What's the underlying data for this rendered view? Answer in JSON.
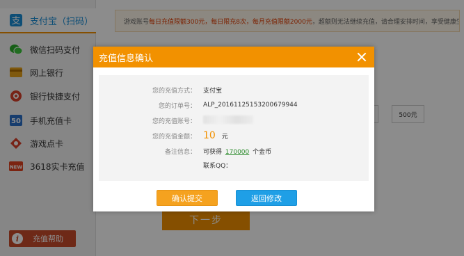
{
  "sidebar": {
    "items": [
      {
        "label": "支付宝（扫码）",
        "icon": "alipay-icon"
      },
      {
        "label": "微信扫码支付",
        "icon": "wechat-icon"
      },
      {
        "label": "网上银行",
        "icon": "bank-card-icon"
      },
      {
        "label": "银行快捷支付",
        "icon": "quick-pay-icon"
      },
      {
        "label": "手机充值卡",
        "icon": "phone-card-icon"
      },
      {
        "label": "游戏点卡",
        "icon": "game-card-icon"
      },
      {
        "label": "3618实卡充值",
        "icon": "new-badge-icon"
      }
    ],
    "help_label": "充值帮助",
    "help_icon_glyph": "i"
  },
  "notice": {
    "prefix": "游戏账号",
    "daily_limit": "每日充值限额300元，每日限充8次，每月充值限额2000元",
    "suffix": "，超额则无法继续充值，请合理安排时间，享受健康生活。"
  },
  "amount_options": [
    "元",
    "500元"
  ],
  "next_label": "下一步",
  "modal": {
    "title": "充值信息确认",
    "rows": {
      "method_label": "您的充值方式：",
      "method_value": "支付宝",
      "order_label": "您的订单号：",
      "order_value": "ALP_20161125153200679944",
      "account_label": "您的充值账号：",
      "amount_label": "您的充值金额：",
      "amount_value": "10",
      "amount_unit": "元",
      "note_label": "备注信息：",
      "note_prefix": "可获得",
      "note_gold": "170000",
      "note_suffix": "个金币",
      "qq_label": "联系QQ："
    },
    "confirm_label": "确认提交",
    "back_label": "返回修改"
  },
  "colors": {
    "accent_orange": "#f29100",
    "button_blue": "#1f9fe6",
    "help_red": "#c84b2a"
  }
}
